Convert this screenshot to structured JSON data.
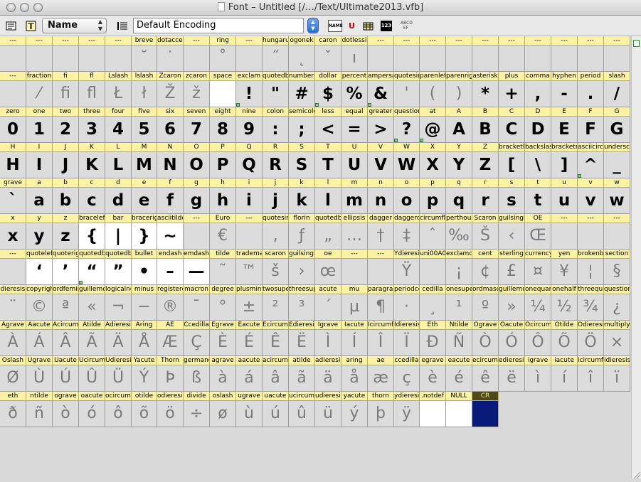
{
  "window": {
    "title": "Font – Untitled [/…/Text/Ultimate2013.vfb]"
  },
  "toolbar": {
    "name_select": "Name",
    "encoding": "Default Encoding",
    "icons": [
      "font-window-icon",
      "glyph-view-icon",
      "list-view-icon",
      "name-mode-icon",
      "unicode-mode-icon",
      "table-view-icon",
      "index-mode-icon",
      "sample-text-icon"
    ],
    "accent": "#2a6fd6"
  },
  "colors": {
    "label_bg": "#fbf3a3",
    "cell_bg": "#dcdcdc",
    "selected_cell": "#071a7a"
  },
  "rows": [
    {
      "cells": [
        {
          "n": "---",
          "g": ""
        },
        {
          "n": "---",
          "g": ""
        },
        {
          "n": "---",
          "g": ""
        },
        {
          "n": "---",
          "g": ""
        },
        {
          "n": "---",
          "g": ""
        },
        {
          "n": "breve",
          "g": "˘"
        },
        {
          "n": "dotaccent",
          "g": "˙"
        },
        {
          "n": "---",
          "g": ""
        },
        {
          "n": "ring",
          "g": "˚"
        },
        {
          "n": "---",
          "g": ""
        },
        {
          "n": "hungarumlaut",
          "g": "˝"
        },
        {
          "n": "ogonek",
          "g": "˛"
        },
        {
          "n": "caron",
          "g": "ˇ"
        },
        {
          "n": "dotlessi",
          "g": "ı"
        },
        {
          "n": "---",
          "g": ""
        },
        {
          "n": "---",
          "g": ""
        },
        {
          "n": "---",
          "g": ""
        },
        {
          "n": "---",
          "g": ""
        },
        {
          "n": "---",
          "g": ""
        },
        {
          "n": "---",
          "g": ""
        },
        {
          "n": "---",
          "g": ""
        },
        {
          "n": "---",
          "g": ""
        },
        {
          "n": "---",
          "g": ""
        },
        {
          "n": "---",
          "g": ""
        }
      ]
    },
    {
      "cells": [
        {
          "n": "---",
          "g": ""
        },
        {
          "n": "fraction",
          "g": "⁄"
        },
        {
          "n": "fi",
          "g": "ﬁ"
        },
        {
          "n": "fl",
          "g": "ﬂ"
        },
        {
          "n": "Lslash",
          "g": "Ł"
        },
        {
          "n": "lslash",
          "g": "ł"
        },
        {
          "n": "Zcaron",
          "g": "Ž"
        },
        {
          "n": "zcaron",
          "g": "ž"
        },
        {
          "n": "space",
          "g": ""
        },
        {
          "n": "exclam",
          "g": "!"
        },
        {
          "n": "quotedbl",
          "g": "\""
        },
        {
          "n": "numbersign",
          "g": "#"
        },
        {
          "n": "dollar",
          "g": "$"
        },
        {
          "n": "percent",
          "g": "%"
        },
        {
          "n": "ampersand",
          "g": "&"
        },
        {
          "n": "quotesingle",
          "g": "'"
        },
        {
          "n": "parenleft",
          "g": "("
        },
        {
          "n": "parenright",
          "g": ")"
        },
        {
          "n": "asterisk",
          "g": "*"
        },
        {
          "n": "plus",
          "g": "+"
        },
        {
          "n": "comma",
          "g": ","
        },
        {
          "n": "hyphen",
          "g": "-"
        },
        {
          "n": "period",
          "g": "."
        },
        {
          "n": "slash",
          "g": "/"
        }
      ]
    },
    {
      "cells": [
        {
          "n": "zero",
          "g": "0"
        },
        {
          "n": "one",
          "g": "1"
        },
        {
          "n": "two",
          "g": "2"
        },
        {
          "n": "three",
          "g": "3"
        },
        {
          "n": "four",
          "g": "4"
        },
        {
          "n": "five",
          "g": "5"
        },
        {
          "n": "six",
          "g": "6"
        },
        {
          "n": "seven",
          "g": "7"
        },
        {
          "n": "eight",
          "g": "8"
        },
        {
          "n": "nine",
          "g": "9"
        },
        {
          "n": "colon",
          "g": ":"
        },
        {
          "n": "semicolon",
          "g": ";"
        },
        {
          "n": "less",
          "g": "<"
        },
        {
          "n": "equal",
          "g": "="
        },
        {
          "n": "greater",
          "g": ">"
        },
        {
          "n": "question",
          "g": "?"
        },
        {
          "n": "at",
          "g": "@"
        },
        {
          "n": "A",
          "g": "A"
        },
        {
          "n": "B",
          "g": "B"
        },
        {
          "n": "C",
          "g": "C"
        },
        {
          "n": "D",
          "g": "D"
        },
        {
          "n": "E",
          "g": "E"
        },
        {
          "n": "F",
          "g": "F"
        },
        {
          "n": "G",
          "g": "G"
        }
      ]
    },
    {
      "cells": [
        {
          "n": "H",
          "g": "H"
        },
        {
          "n": "I",
          "g": "I"
        },
        {
          "n": "J",
          "g": "J"
        },
        {
          "n": "K",
          "g": "K"
        },
        {
          "n": "L",
          "g": "L"
        },
        {
          "n": "M",
          "g": "M"
        },
        {
          "n": "N",
          "g": "N"
        },
        {
          "n": "O",
          "g": "O"
        },
        {
          "n": "P",
          "g": "P"
        },
        {
          "n": "Q",
          "g": "Q"
        },
        {
          "n": "R",
          "g": "R"
        },
        {
          "n": "S",
          "g": "S"
        },
        {
          "n": "T",
          "g": "T"
        },
        {
          "n": "U",
          "g": "U"
        },
        {
          "n": "V",
          "g": "V"
        },
        {
          "n": "W",
          "g": "W"
        },
        {
          "n": "X",
          "g": "X"
        },
        {
          "n": "Y",
          "g": "Y"
        },
        {
          "n": "Z",
          "g": "Z"
        },
        {
          "n": "bracketleft",
          "g": "["
        },
        {
          "n": "backslash",
          "g": "\\"
        },
        {
          "n": "bracketright",
          "g": "]"
        },
        {
          "n": "asciicircum",
          "g": "^"
        },
        {
          "n": "underscore",
          "g": "_"
        }
      ]
    },
    {
      "cells": [
        {
          "n": "grave",
          "g": "`"
        },
        {
          "n": "a",
          "g": "a"
        },
        {
          "n": "b",
          "g": "b"
        },
        {
          "n": "c",
          "g": "c"
        },
        {
          "n": "d",
          "g": "d"
        },
        {
          "n": "e",
          "g": "e"
        },
        {
          "n": "f",
          "g": "f"
        },
        {
          "n": "g",
          "g": "g"
        },
        {
          "n": "h",
          "g": "h"
        },
        {
          "n": "i",
          "g": "i"
        },
        {
          "n": "j",
          "g": "j"
        },
        {
          "n": "k",
          "g": "k"
        },
        {
          "n": "l",
          "g": "l"
        },
        {
          "n": "m",
          "g": "m"
        },
        {
          "n": "n",
          "g": "n"
        },
        {
          "n": "o",
          "g": "o"
        },
        {
          "n": "p",
          "g": "p"
        },
        {
          "n": "q",
          "g": "q"
        },
        {
          "n": "r",
          "g": "r"
        },
        {
          "n": "s",
          "g": "s"
        },
        {
          "n": "t",
          "g": "t"
        },
        {
          "n": "u",
          "g": "u"
        },
        {
          "n": "v",
          "g": "v"
        },
        {
          "n": "w",
          "g": "w"
        }
      ]
    },
    {
      "cells": [
        {
          "n": "x",
          "g": "x"
        },
        {
          "n": "y",
          "g": "y"
        },
        {
          "n": "z",
          "g": "z"
        },
        {
          "n": "braceleft",
          "g": "{"
        },
        {
          "n": "bar",
          "g": "|"
        },
        {
          "n": "braceright",
          "g": "}"
        },
        {
          "n": "asciitilde",
          "g": "~"
        },
        {
          "n": "---",
          "g": ""
        },
        {
          "n": "Euro",
          "g": "€"
        },
        {
          "n": "---",
          "g": ""
        },
        {
          "n": "quotesinglbase",
          "g": "‚"
        },
        {
          "n": "florin",
          "g": "ƒ"
        },
        {
          "n": "quotedblbase",
          "g": "„"
        },
        {
          "n": "ellipsis",
          "g": "…"
        },
        {
          "n": "dagger",
          "g": "†"
        },
        {
          "n": "daggerdbl",
          "g": "‡"
        },
        {
          "n": "circumflex",
          "g": "ˆ"
        },
        {
          "n": "perthousand",
          "g": "‰"
        },
        {
          "n": "Scaron",
          "g": "Š"
        },
        {
          "n": "guilsinglleft",
          "g": "‹"
        },
        {
          "n": "OE",
          "g": "Œ"
        },
        {
          "n": "---",
          "g": ""
        },
        {
          "n": "---",
          "g": ""
        },
        {
          "n": "---",
          "g": ""
        }
      ]
    },
    {
      "cells": [
        {
          "n": "---",
          "g": ""
        },
        {
          "n": "quoteleft",
          "g": "‘"
        },
        {
          "n": "quoteright",
          "g": "’"
        },
        {
          "n": "quotedblleft",
          "g": "“"
        },
        {
          "n": "quotedblright",
          "g": "”"
        },
        {
          "n": "bullet",
          "g": "•"
        },
        {
          "n": "endash",
          "g": "–"
        },
        {
          "n": "emdash",
          "g": "—"
        },
        {
          "n": "tilde",
          "g": "˜"
        },
        {
          "n": "trademark",
          "g": "™"
        },
        {
          "n": "scaron",
          "g": "š"
        },
        {
          "n": "guilsinglright",
          "g": "›"
        },
        {
          "n": "oe",
          "g": "œ"
        },
        {
          "n": "---",
          "g": ""
        },
        {
          "n": "---",
          "g": ""
        },
        {
          "n": "Ydieresis",
          "g": "Ÿ"
        },
        {
          "n": "uni00A0",
          "g": ""
        },
        {
          "n": "exclamdown",
          "g": "¡"
        },
        {
          "n": "cent",
          "g": "¢"
        },
        {
          "n": "sterling",
          "g": "£"
        },
        {
          "n": "currency",
          "g": "¤"
        },
        {
          "n": "yen",
          "g": "¥"
        },
        {
          "n": "brokenbar",
          "g": "¦"
        },
        {
          "n": "section",
          "g": "§"
        }
      ]
    },
    {
      "cells": [
        {
          "n": "dieresis",
          "g": "¨"
        },
        {
          "n": "copyright",
          "g": "©"
        },
        {
          "n": "ordfeminine",
          "g": "ª"
        },
        {
          "n": "guillemotleft",
          "g": "«"
        },
        {
          "n": "logicalnot",
          "g": "¬"
        },
        {
          "n": "minus",
          "g": "−"
        },
        {
          "n": "registered",
          "g": "®"
        },
        {
          "n": "macron",
          "g": "¯"
        },
        {
          "n": "degree",
          "g": "°"
        },
        {
          "n": "plusminus",
          "g": "±"
        },
        {
          "n": "twosuperior",
          "g": "²"
        },
        {
          "n": "threesuperior",
          "g": "³"
        },
        {
          "n": "acute",
          "g": "´"
        },
        {
          "n": "mu",
          "g": "µ"
        },
        {
          "n": "paragraph",
          "g": "¶"
        },
        {
          "n": "periodcentered",
          "g": "·"
        },
        {
          "n": "cedilla",
          "g": "¸"
        },
        {
          "n": "onesuperior",
          "g": "¹"
        },
        {
          "n": "ordmasculine",
          "g": "º"
        },
        {
          "n": "guillemotright",
          "g": "»"
        },
        {
          "n": "onequarter",
          "g": "¼"
        },
        {
          "n": "onehalf",
          "g": "½"
        },
        {
          "n": "threequarters",
          "g": "¾"
        },
        {
          "n": "questiondown",
          "g": "¿"
        }
      ]
    },
    {
      "cells": [
        {
          "n": "Agrave",
          "g": "À"
        },
        {
          "n": "Aacute",
          "g": "Á"
        },
        {
          "n": "Acircumflex",
          "g": "Â"
        },
        {
          "n": "Atilde",
          "g": "Ã"
        },
        {
          "n": "Adieresis",
          "g": "Ä"
        },
        {
          "n": "Aring",
          "g": "Å"
        },
        {
          "n": "AE",
          "g": "Æ"
        },
        {
          "n": "Ccedilla",
          "g": "Ç"
        },
        {
          "n": "Egrave",
          "g": "È"
        },
        {
          "n": "Eacute",
          "g": "É"
        },
        {
          "n": "Ecircumflex",
          "g": "Ê"
        },
        {
          "n": "Edieresis",
          "g": "Ë"
        },
        {
          "n": "Igrave",
          "g": "Ì"
        },
        {
          "n": "Iacute",
          "g": "Í"
        },
        {
          "n": "Icircumflex",
          "g": "Î"
        },
        {
          "n": "Idieresis",
          "g": "Ï"
        },
        {
          "n": "Eth",
          "g": "Ð"
        },
        {
          "n": "Ntilde",
          "g": "Ñ"
        },
        {
          "n": "Ograve",
          "g": "Ò"
        },
        {
          "n": "Oacute",
          "g": "Ó"
        },
        {
          "n": "Ocircumflex",
          "g": "Ô"
        },
        {
          "n": "Otilde",
          "g": "Õ"
        },
        {
          "n": "Odieresis",
          "g": "Ö"
        },
        {
          "n": "multiply",
          "g": "×"
        }
      ]
    },
    {
      "cells": [
        {
          "n": "Oslash",
          "g": "Ø"
        },
        {
          "n": "Ugrave",
          "g": "Ù"
        },
        {
          "n": "Uacute",
          "g": "Ú"
        },
        {
          "n": "Ucircumflex",
          "g": "Û"
        },
        {
          "n": "Udieresis",
          "g": "Ü"
        },
        {
          "n": "Yacute",
          "g": "Ý"
        },
        {
          "n": "Thorn",
          "g": "Þ"
        },
        {
          "n": "germandbls",
          "g": "ß"
        },
        {
          "n": "agrave",
          "g": "à"
        },
        {
          "n": "aacute",
          "g": "á"
        },
        {
          "n": "acircumflex",
          "g": "â"
        },
        {
          "n": "atilde",
          "g": "ã"
        },
        {
          "n": "adieresis",
          "g": "ä"
        },
        {
          "n": "aring",
          "g": "å"
        },
        {
          "n": "ae",
          "g": "æ"
        },
        {
          "n": "ccedilla",
          "g": "ç"
        },
        {
          "n": "egrave",
          "g": "è"
        },
        {
          "n": "eacute",
          "g": "é"
        },
        {
          "n": "ecircumflex",
          "g": "ê"
        },
        {
          "n": "edieresis",
          "g": "ë"
        },
        {
          "n": "igrave",
          "g": "ì"
        },
        {
          "n": "iacute",
          "g": "í"
        },
        {
          "n": "icircumflex",
          "g": "î"
        },
        {
          "n": "idieresis",
          "g": "ï"
        }
      ]
    },
    {
      "cells": [
        {
          "n": "eth",
          "g": "ð"
        },
        {
          "n": "ntilde",
          "g": "ñ"
        },
        {
          "n": "ograve",
          "g": "ò"
        },
        {
          "n": "oacute",
          "g": "ó"
        },
        {
          "n": "ocircumflex",
          "g": "ô"
        },
        {
          "n": "otilde",
          "g": "õ"
        },
        {
          "n": "odieresis",
          "g": "ö"
        },
        {
          "n": "divide",
          "g": "÷"
        },
        {
          "n": "oslash",
          "g": "ø"
        },
        {
          "n": "ugrave",
          "g": "ù"
        },
        {
          "n": "uacute",
          "g": "ú"
        },
        {
          "n": "ucircumflex",
          "g": "û"
        },
        {
          "n": "udieresis",
          "g": "ü"
        },
        {
          "n": "yacute",
          "g": "ý"
        },
        {
          "n": "thorn",
          "g": "þ"
        },
        {
          "n": "ydieresis",
          "g": "ÿ"
        },
        {
          "n": ".notdef",
          "g": ""
        },
        {
          "n": "NULL",
          "g": ""
        },
        {
          "n": "CR",
          "g": ""
        }
      ]
    }
  ]
}
